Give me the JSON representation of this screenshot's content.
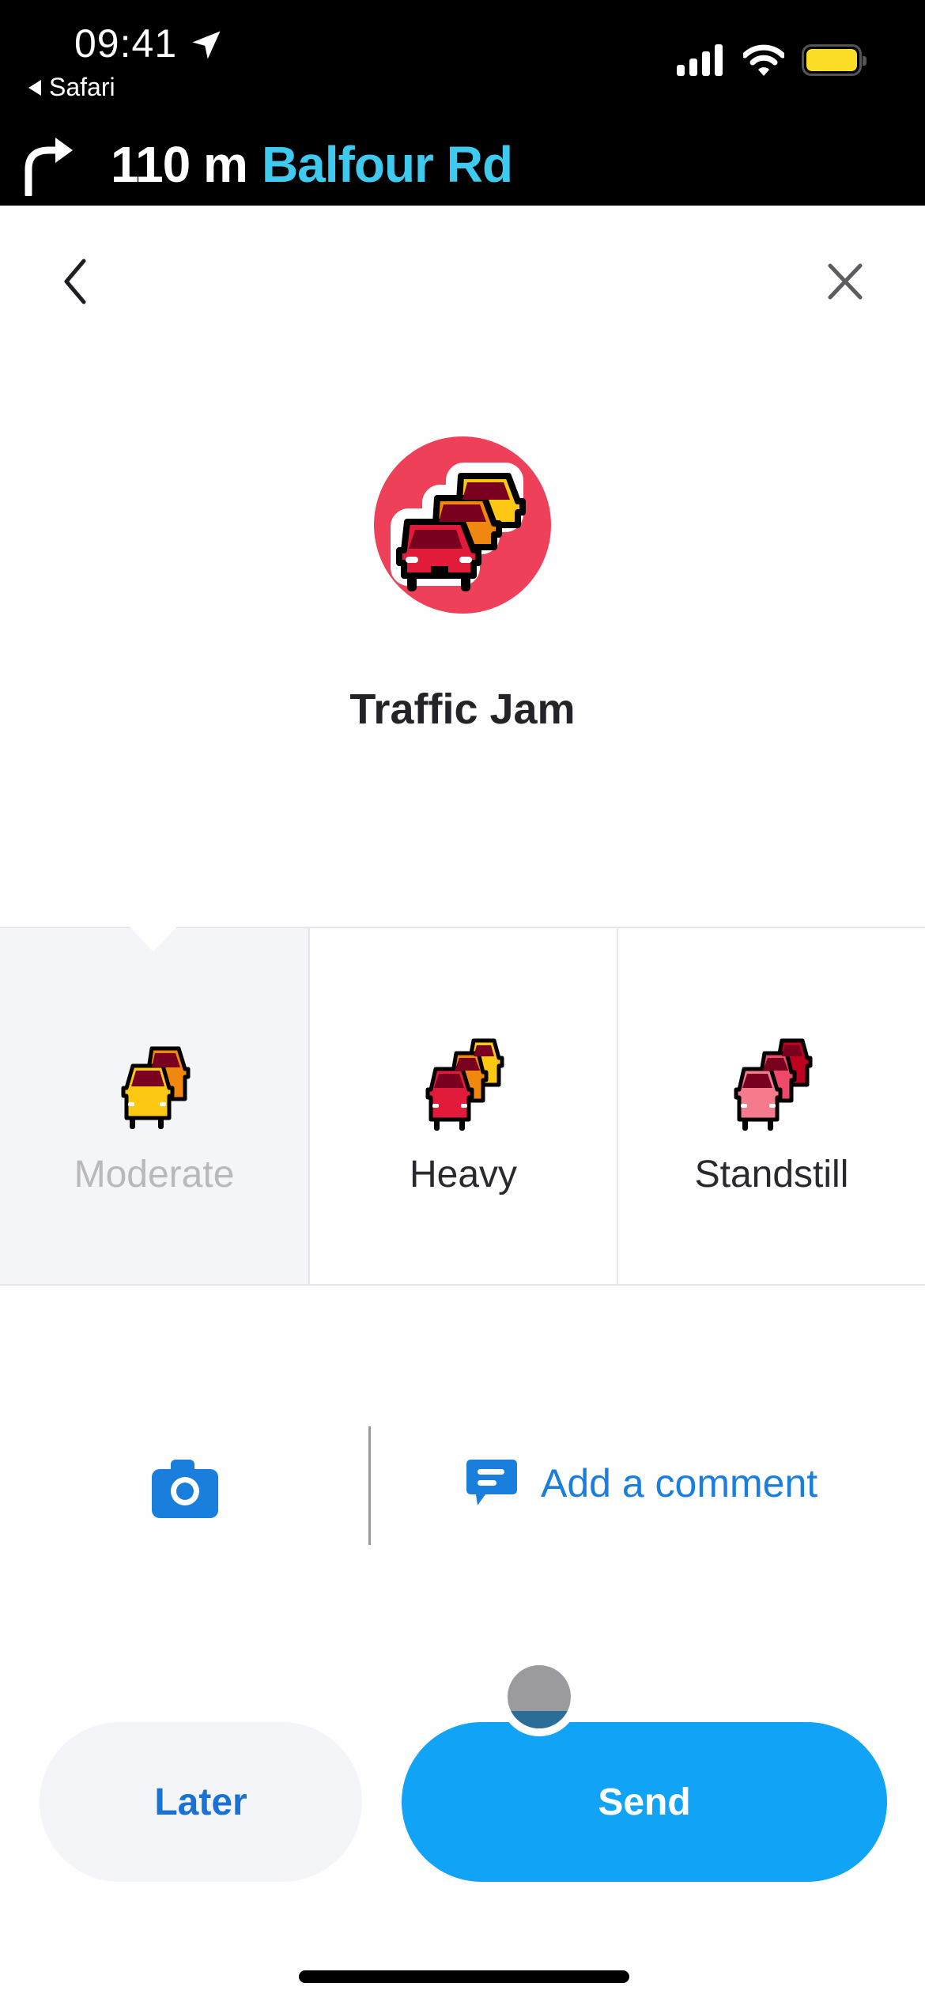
{
  "status_bar": {
    "time": "09:41",
    "back_app_label": "Safari",
    "icons": [
      "location-arrow-icon",
      "cellular-signal-icon",
      "wifi-icon",
      "battery-icon"
    ],
    "battery_color": "#fbdd25"
  },
  "navigation": {
    "turn_icon": "turn-right-icon",
    "distance": "110 m",
    "street": "Balfour Rd",
    "street_color": "#3ec9ee"
  },
  "header": {
    "back_icon": "chevron-left-icon",
    "close_icon": "close-icon"
  },
  "report": {
    "icon": "traffic-jam-icon",
    "icon_bg": "#ee4159",
    "title": "Traffic Jam"
  },
  "options": [
    {
      "label": "Moderate",
      "icon": "moderate-traffic-icon",
      "selected": true
    },
    {
      "label": "Heavy",
      "icon": "heavy-traffic-icon",
      "selected": false
    },
    {
      "label": "Standstill",
      "icon": "standstill-traffic-icon",
      "selected": false
    }
  ],
  "actions": {
    "camera_icon": "camera-icon",
    "comment_icon": "comment-icon",
    "comment_label": "Add a comment",
    "accent": "#1a7fdc"
  },
  "buttons": {
    "later_label": "Later",
    "send_label": "Send",
    "send_color": "#11a3f6"
  }
}
